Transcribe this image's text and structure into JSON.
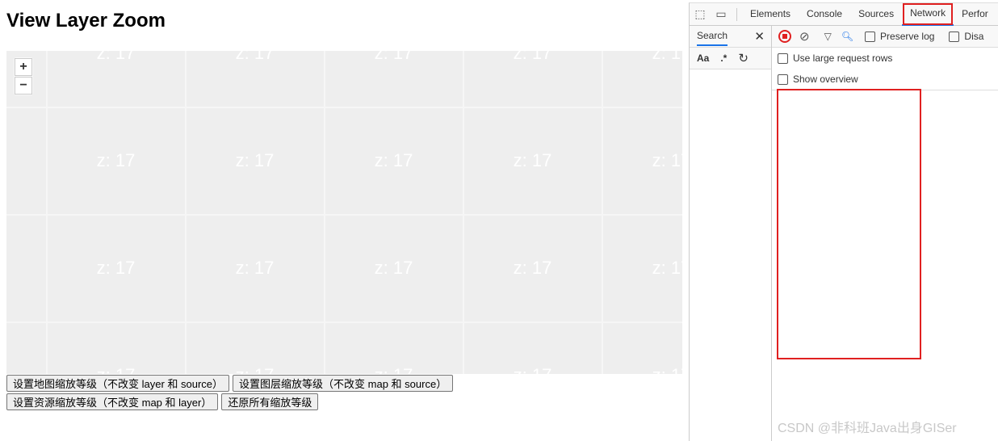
{
  "page": {
    "title": "View Layer Zoom"
  },
  "map": {
    "tile_label": "z: 17",
    "zoom_in": "+",
    "zoom_out": "−"
  },
  "buttons": [
    "设置地图缩放等级（不改变 layer 和 source）",
    "设置图层缩放等级（不改变 map 和 source）",
    "设置资源缩放等级（不改变 map 和 layer）",
    "还原所有缩放等级"
  ],
  "devtools": {
    "tabs": [
      "Elements",
      "Console",
      "Sources",
      "Network",
      "Perfor"
    ],
    "active_tab": "Network",
    "search_tab": "Search",
    "search_opts": [
      "Aa",
      ".*"
    ],
    "preserve_log": "Preserve log",
    "disable_cache": "Disa",
    "large_rows": "Use large request rows",
    "show_overview": "Show overview",
    "highlight_color": "#e02020"
  },
  "watermark": "CSDN @非科班Java出身GISer"
}
